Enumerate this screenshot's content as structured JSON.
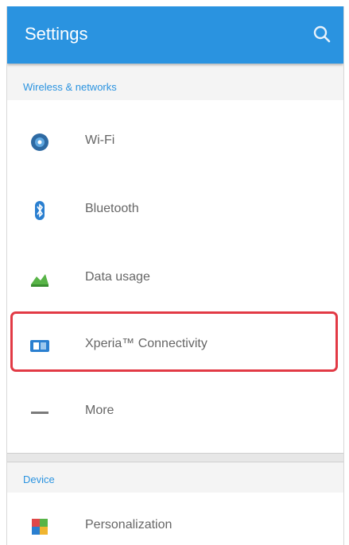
{
  "appbar": {
    "title": "Settings",
    "search_icon": "search-icon"
  },
  "sections": {
    "wireless_header": "Wireless & networks",
    "device_header": "Device"
  },
  "rows": [
    {
      "label": "Wi-Fi",
      "icon": "wifi-icon"
    },
    {
      "label": "Bluetooth",
      "icon": "bluetooth-icon"
    },
    {
      "label": "Data usage",
      "icon": "data-usage-icon"
    },
    {
      "label": "Xperia™ Connectivity",
      "icon": "xperia-connectivity-icon"
    },
    {
      "label": "More",
      "icon": "more-icon"
    },
    {
      "label": "Personalization",
      "icon": "personalization-icon"
    }
  ],
  "colors": {
    "accent": "#2a93e0",
    "highlight": "#e23a45"
  }
}
